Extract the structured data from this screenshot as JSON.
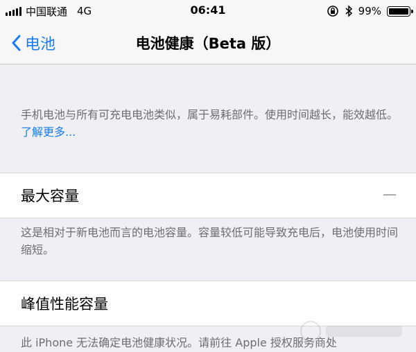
{
  "status": {
    "carrier": "中国联通",
    "network": "4G",
    "time": "06:41",
    "battery": "99%",
    "battery_level": 0.99
  },
  "nav": {
    "back_label": "电池",
    "title": "电池健康（Beta 版）"
  },
  "intro": {
    "text": "手机电池与所有可充电电池类似，属于易耗部件。使用时间越长，能效越低。",
    "link": "了解更多..."
  },
  "max_capacity": {
    "label": "最大容量",
    "value": "—",
    "note": "这是相对于新电池而言的电池容量。容量较低可能导致充电后，电池使用时间缩短。"
  },
  "peak_performance": {
    "label": "峰值性能容量",
    "note": "此 iPhone 无法确定电池健康状况。请前往 Apple 授权服务商处"
  },
  "colors": {
    "accent": "#1a7cf5",
    "background": "#efeff4",
    "secondary_text": "#6d6d72"
  },
  "icons": [
    "signal-bars-icon",
    "orientation-lock-icon",
    "bluetooth-icon",
    "battery-icon",
    "chevron-left-icon"
  ]
}
